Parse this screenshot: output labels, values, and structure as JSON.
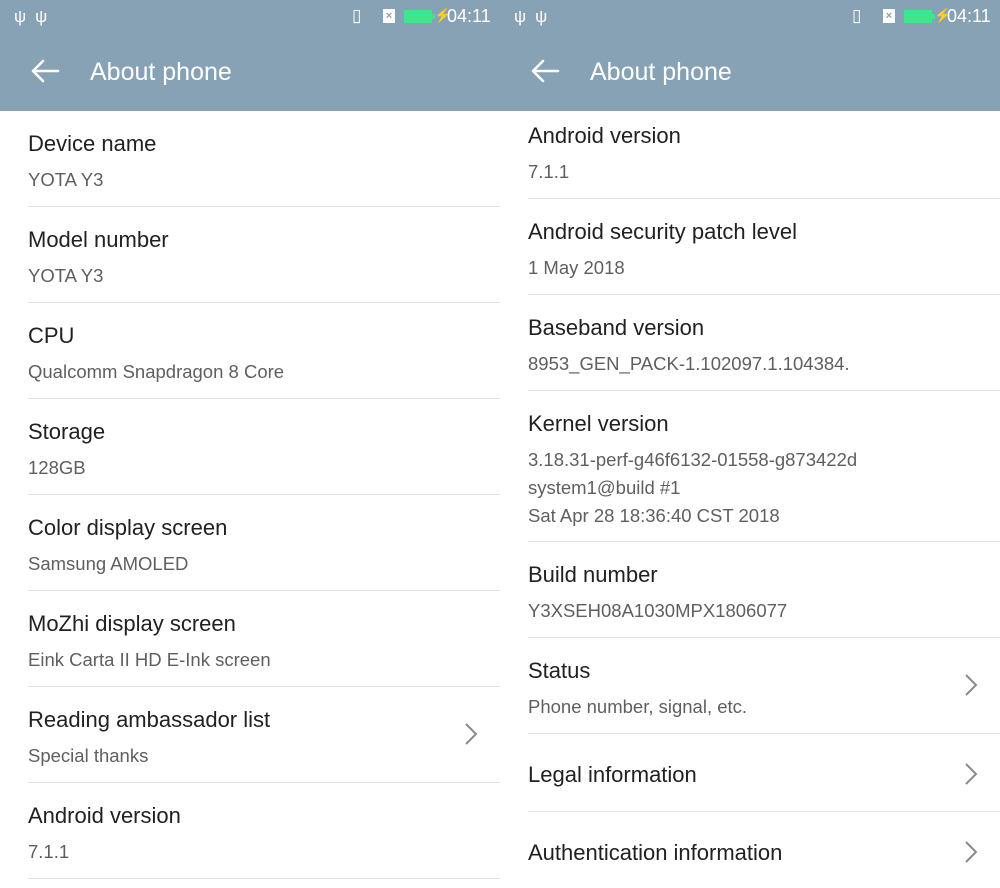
{
  "status_bar": {
    "time": "04:11",
    "left_icons": [
      "usb-icon",
      "usb-icon"
    ],
    "right_icons": [
      "vibrate-icon",
      "no-sim-icon",
      "battery-charging-icon"
    ],
    "battery_color": "#3ee58a"
  },
  "colors": {
    "app_bar": "#87a2b5",
    "primary_text": "#212121",
    "secondary_text": "#5f5f5f"
  },
  "left_screen": {
    "title": "About phone",
    "items": [
      {
        "label": "Device name",
        "value": "YOTA Y3"
      },
      {
        "label": "Model number",
        "value": "YOTA Y3"
      },
      {
        "label": "CPU",
        "value": "Qualcomm Snapdragon 8 Core"
      },
      {
        "label": "Storage",
        "value": "128GB"
      },
      {
        "label": "Color display screen",
        "value": "Samsung AMOLED"
      },
      {
        "label": "MoZhi display screen",
        "value": "Eink Carta II HD E-Ink screen"
      },
      {
        "label": "Reading ambassador list",
        "value": "Special thanks"
      },
      {
        "label": "Android version",
        "value": "7.1.1"
      }
    ]
  },
  "right_screen": {
    "title": "About phone",
    "items": [
      {
        "label": "Android version",
        "value": "7.1.1"
      },
      {
        "label": "Android security patch level",
        "value": "1 May 2018"
      },
      {
        "label": "Baseband version",
        "value": "8953_GEN_PACK-1.102097.1.104384."
      },
      {
        "label": "Kernel version",
        "value_lines": [
          "3.18.31-perf-g46f6132-01558-g873422d",
          "system1@build #1",
          "Sat Apr 28 18:36:40 CST 2018"
        ]
      },
      {
        "label": "Build number",
        "value": "Y3XSEH08A1030MPX1806077"
      },
      {
        "label": "Status",
        "value": "Phone number, signal, etc."
      },
      {
        "label": "Legal information"
      },
      {
        "label": "Authentication information"
      }
    ]
  }
}
